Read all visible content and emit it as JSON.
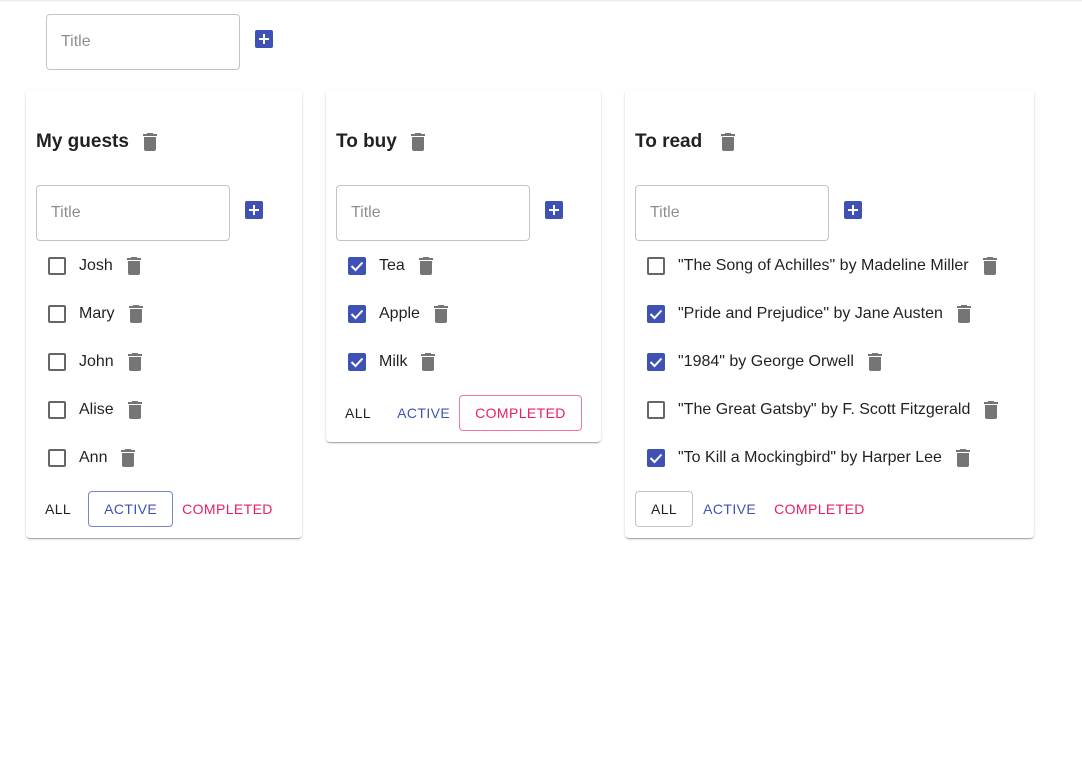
{
  "colors": {
    "primary": "#3f51b5",
    "secondary": "#e91e63",
    "icon_gray": "#757575"
  },
  "icons": {
    "add": "add-box-icon",
    "delete": "trash-icon",
    "check": "check-box-icon"
  },
  "new_list": {
    "placeholder": "Title"
  },
  "lists": [
    {
      "title": "My guests",
      "input_placeholder": "Title",
      "items": [
        {
          "label": "Josh",
          "checked": false
        },
        {
          "label": "Mary",
          "checked": false
        },
        {
          "label": "John",
          "checked": false
        },
        {
          "label": "Alise",
          "checked": false
        },
        {
          "label": "Ann",
          "checked": false
        }
      ],
      "filters": {
        "all": "ALL",
        "active": "ACTIVE",
        "completed": "COMPLETED"
      },
      "selected_filter": "active"
    },
    {
      "title": "To buy",
      "input_placeholder": "Title",
      "items": [
        {
          "label": "Tea",
          "checked": true
        },
        {
          "label": "Apple",
          "checked": true
        },
        {
          "label": "Milk",
          "checked": true
        }
      ],
      "filters": {
        "all": "ALL",
        "active": "ACTIVE",
        "completed": "COMPLETED"
      },
      "selected_filter": "completed"
    },
    {
      "title": "To read",
      "input_placeholder": "Title",
      "items": [
        {
          "label": "\"The Song of Achilles\" by Madeline Miller",
          "checked": false
        },
        {
          "label": "\"Pride and Prejudice\" by Jane Austen",
          "checked": true
        },
        {
          "label": "\"1984\" by George Orwell",
          "checked": true
        },
        {
          "label": "\"The Great Gatsby\" by F. Scott Fitzgerald",
          "checked": false
        },
        {
          "label": "\"To Kill a Mockingbird\" by Harper Lee",
          "checked": true
        }
      ],
      "filters": {
        "all": "ALL",
        "active": "ACTIVE",
        "completed": "COMPLETED"
      },
      "selected_filter": "all"
    }
  ]
}
